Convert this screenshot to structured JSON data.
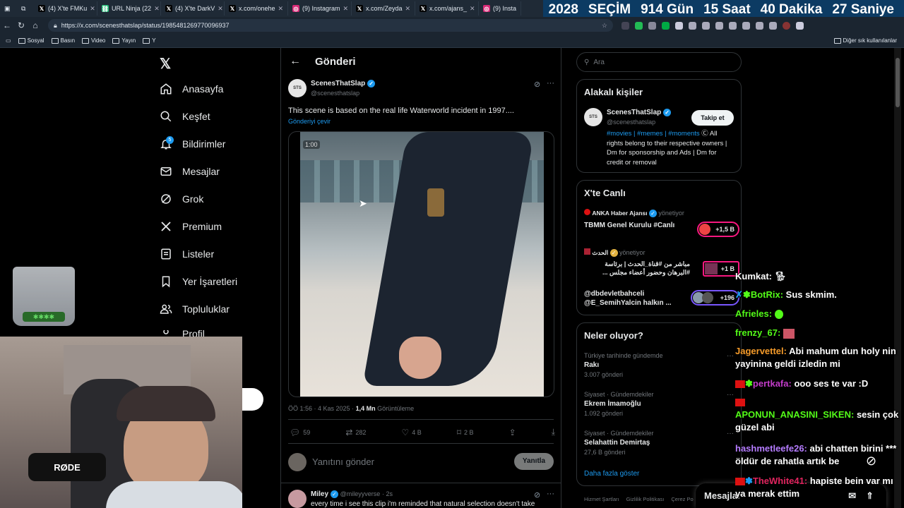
{
  "tabs": [
    {
      "label": "(4) X'te FMKu",
      "icon": "x-icon"
    },
    {
      "label": "URL Ninja (22",
      "icon": "link-icon"
    },
    {
      "label": "(4) X'te DarkV",
      "icon": "x-icon"
    },
    {
      "label": "x.com/onehe",
      "icon": "x-icon"
    },
    {
      "label": "(9) Instagram",
      "icon": "instagram-icon"
    },
    {
      "label": "x.com/Zeyda",
      "icon": "x-icon"
    },
    {
      "label": "x.com/ajans_",
      "icon": "x-icon"
    },
    {
      "label": "(9) Insta",
      "icon": "instagram-icon"
    }
  ],
  "banner": {
    "year": "2028",
    "label": "SEÇİM",
    "days": "914 Gün",
    "hours": "15 Saat",
    "minutes": "40 Dakika",
    "seconds": "27 Saniye"
  },
  "url": "https://x.com/scenesthatslap/status/1985481269770096937",
  "bookmarks": [
    "Sosyal",
    "Basın",
    "Video",
    "Yayın",
    "Y"
  ],
  "bookmarks_other": "Diğer sık kullanılanlar",
  "nav": [
    {
      "label": "Anasayfa",
      "icon": "home-icon"
    },
    {
      "label": "Keşfet",
      "icon": "search-icon"
    },
    {
      "label": "Bildirimler",
      "icon": "bell-icon",
      "badge": "5"
    },
    {
      "label": "Mesajlar",
      "icon": "mail-icon"
    },
    {
      "label": "Grok",
      "icon": "grok-icon"
    },
    {
      "label": "Premium",
      "icon": "x-icon"
    },
    {
      "label": "Listeler",
      "icon": "list-icon"
    },
    {
      "label": "Yer İşaretleri",
      "icon": "bookmark-icon"
    },
    {
      "label": "Topluluklar",
      "icon": "people-icon"
    },
    {
      "label": "Profil",
      "icon": "user-icon"
    }
  ],
  "post": {
    "header": "Gönderi",
    "name": "ScenesThatSlap",
    "handle": "@scenesthatslap",
    "text": "This scene is based on the real life Waterworld incident in 1997....",
    "translate": "Gönderiyi çevir",
    "video_time": "1:00",
    "meta_time": "ÖÖ 1:56 · 4 Kas 2025 ·",
    "views": "1,4 Mn",
    "views_label": "Görüntüleme",
    "replies": "59",
    "reposts": "282",
    "likes": "4 B",
    "bookmarks": "2 B",
    "reply_placeholder": "Yanıtını gönder",
    "reply_button": "Yanıtla"
  },
  "next_reply": {
    "name": "Miley",
    "handle": "@mileyyverse",
    "time": "· 2s",
    "text": "every time i see this clip i'm reminded that natural selection doesn't take"
  },
  "search_placeholder": "Ara",
  "related": {
    "title": "Alakalı kişiler",
    "name": "ScenesThatSlap",
    "handle": "@scenesthatslap",
    "follow": "Takip et",
    "bio_tags": "#movies | #memes | #moments",
    "bio_rest": "All rights belong to their respective owners | Dm for sponsorship and Ads | Dm for credit or removal"
  },
  "live": {
    "title": "X'te Canlı",
    "items": [
      {
        "host": "ANKA Haber Ajansı",
        "status": "yönetiyor",
        "title": "TBMM Genel Kurulu #Canlı",
        "count": "+1,5 B"
      },
      {
        "host": "الحدث",
        "status": "yönetiyor",
        "title": "مباشر من #قناة_الحدث | برئاسة #البرهان وحضور أعضاء مجلس ...",
        "count": "+1 B"
      },
      {
        "host": "@dbdevletbahceli",
        "status": "",
        "title": "@E_SemihYalcin halkın ...",
        "count": "+196"
      }
    ]
  },
  "trends": {
    "title": "Neler oluyor?",
    "items": [
      {
        "category": "Türkiye tarihinde gündemde",
        "name": "Rakı",
        "posts": "3.007 gönderi"
      },
      {
        "category": "Siyaset · Gündemdekiler",
        "name": "Ekrem İmamoğlu",
        "posts": "1.092 gönderi"
      },
      {
        "category": "Siyaset · Gündemdekiler",
        "name": "Selahattin Demirtaş",
        "posts": "27,6 B gönderi"
      }
    ],
    "more": "Daha fazla göster"
  },
  "footer": [
    "Hizmet Şartları",
    "Gizlilik Politikası",
    "Çerez Po"
  ],
  "messages_drawer": "Mesajlar",
  "mic_brand": "RØDE",
  "chat": [
    {
      "user": "Kumkat:",
      "text": "",
      "color": "#ffffff"
    },
    {
      "user": "BotRix:",
      "text": "Sus skmim.",
      "color": "#53fc18"
    },
    {
      "user": "Afrieles:",
      "text": "",
      "color": "#53fc18"
    },
    {
      "user": "frenzy_67:",
      "text": "",
      "color": "#53fc18"
    },
    {
      "user": "Jagervettel:",
      "text": "Abi mahum dun holy nin yayinina geldi izledin mi",
      "color": "#f59b2a"
    },
    {
      "user": "pertkafa:",
      "text": "ooo ses te var :D",
      "color": "#c23cc9"
    },
    {
      "user": "APONUN_ANASINI_SIKEN:",
      "text": "sesin çok güzel abi",
      "color": "#53fc18"
    },
    {
      "user": "hashmetleefe26:",
      "text": "abi chatten birini *** öldür de rahatla artık be",
      "color": "#b57cff"
    },
    {
      "user": "TheWhite41:",
      "text": "hapiste bein var mı ya merak ettim",
      "color": "#e0245e"
    }
  ],
  "colors": {
    "accent": "#1d9bf0",
    "live_ring": "#f91880",
    "chat_green": "#53fc18"
  }
}
